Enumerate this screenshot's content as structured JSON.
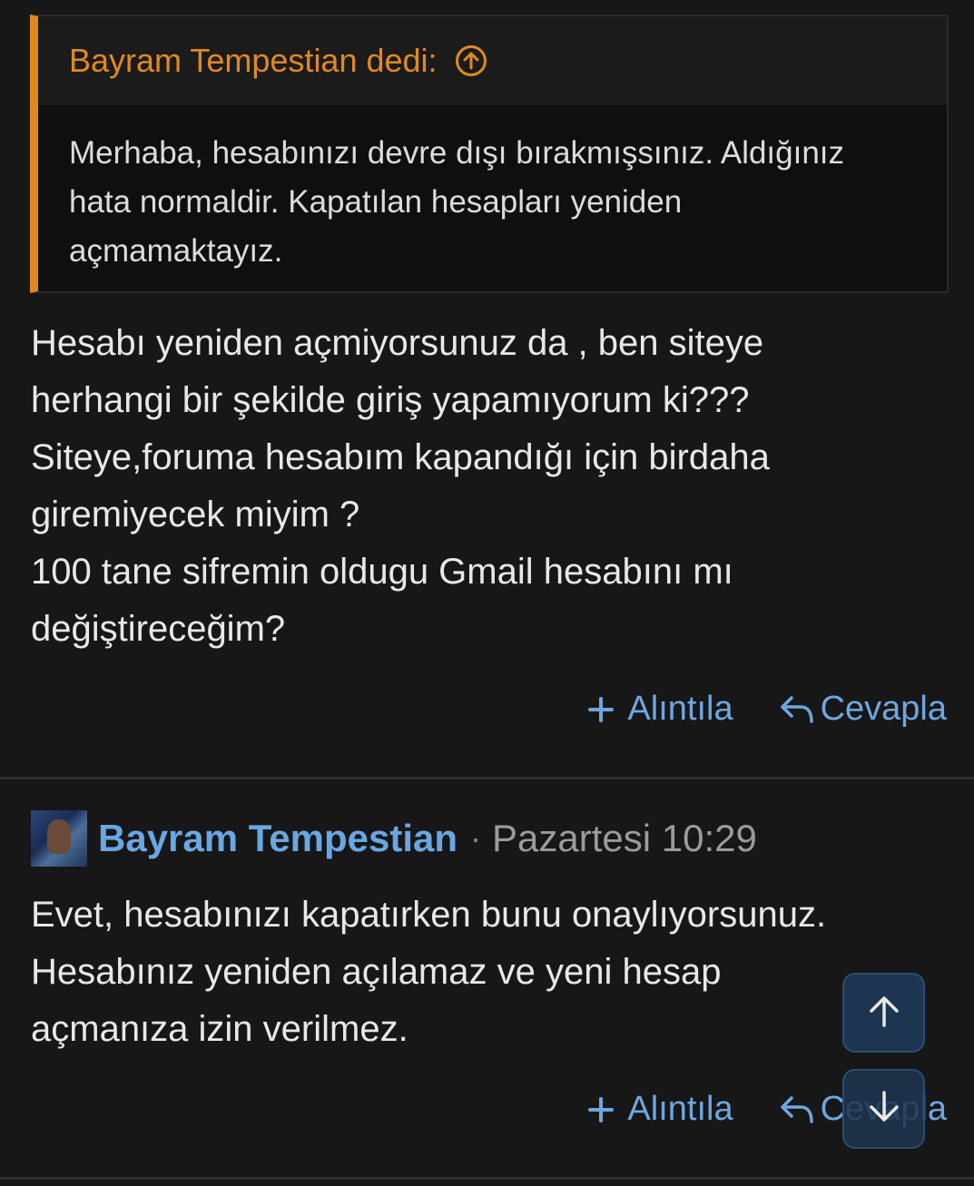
{
  "quote": {
    "author_label": "Bayram Tempestian dedi:",
    "lines": [
      "Merhaba, hesabınızı devre dışı bırakmışsınız. Aldığınız",
      "hata normaldir. Kapatılan hesapları yeniden",
      "açmamaktayız."
    ]
  },
  "message1": {
    "lines": [
      "Hesabı yeniden açmiyorsunuz da , ben siteye",
      "herhangi bir şekilde giriş yapamıyorum ki???",
      "Siteye,foruma hesabım kapandığı için birdaha",
      "giremiyecek miyim ?",
      "100 tane sifremin oldugu Gmail hesabını mı",
      "değiştireceğim?"
    ]
  },
  "actions": {
    "quote_label": "Alıntıla",
    "reply_label": "Cevapla"
  },
  "post2": {
    "author": "Bayram Tempestian",
    "separator": "·",
    "time": "Pazartesi 10:29",
    "lines": [
      "Evet, hesabınızı kapatırken bunu onaylıyorsunuz.",
      "Hesabınız yeniden açılamaz ve yeni hesap",
      "açmanıza izin verilmez."
    ]
  },
  "icons": {
    "quote_jump": "arrow-up-circle-icon",
    "add": "plus-icon",
    "reply": "reply-arrow-icon",
    "scroll_up": "arrow-up-icon",
    "scroll_down": "arrow-down-icon"
  },
  "colors": {
    "background": "#171717",
    "quote_accent": "#e08a1e",
    "link": "#6ea7e0",
    "author": "#69a7e2",
    "fab_bg": "#1d3550"
  }
}
